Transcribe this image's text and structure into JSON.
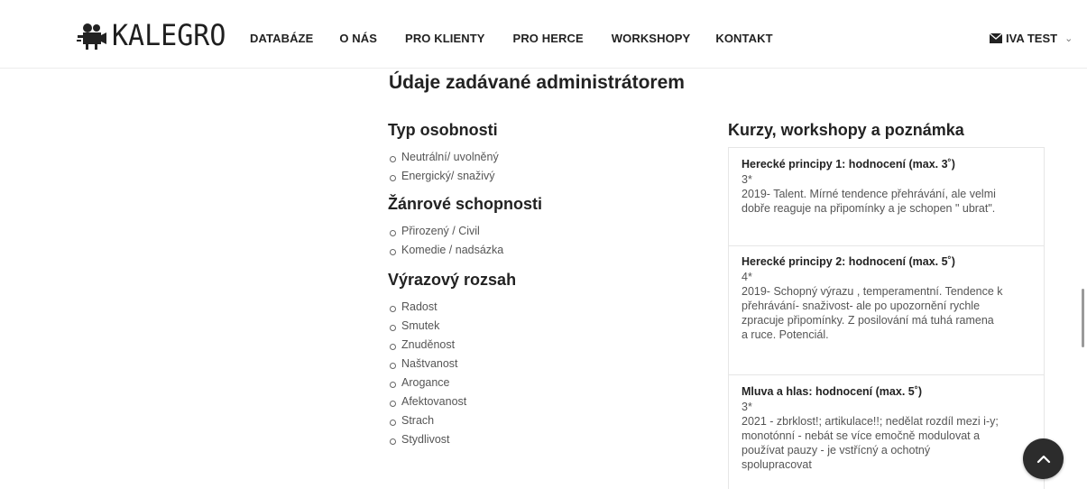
{
  "brand": {
    "name": "KALEGRO"
  },
  "nav": {
    "items": [
      {
        "label": "DATABÁZE"
      },
      {
        "label": "O NÁS"
      },
      {
        "label": "PRO KLIENTY"
      },
      {
        "label": "PRO HERCE"
      },
      {
        "label": "WORKSHOPY"
      },
      {
        "label": "KONTAKT"
      }
    ],
    "user": {
      "label": "IVA TEST",
      "icon": "envelope-icon"
    }
  },
  "page": {
    "title": "Údaje zadávané administrátorem"
  },
  "left": {
    "sections": [
      {
        "heading": "Typ osobnosti",
        "items": [
          "Neutrální/ uvolněný",
          "Energický/ snaživý"
        ]
      },
      {
        "heading": "Žánrové schopnosti",
        "items": [
          "Přirozený / Civil",
          "Komedie / nadsázka"
        ]
      },
      {
        "heading": "Výrazový rozsah",
        "items": [
          "Radost",
          "Smutek",
          "Znuděnost",
          "Naštvanost",
          "Arogance",
          "Afektovanost",
          "Strach",
          "Stydlivost"
        ]
      }
    ]
  },
  "right": {
    "heading": "Kurzy, workshopy a poznámka",
    "items": [
      {
        "title": "Herecké principy 1: hodnocení (max. 3˚)",
        "rating": "3*",
        "lines": [
          "2019- Talent. Mírné tendence přehrávání, ale velmi",
          "dobře reaguje na připomínky a je schopen \" ubrat\"."
        ]
      },
      {
        "title": "Herecké principy 2: hodnocení (max. 5˚)",
        "rating": "4*",
        "lines": [
          "2019- Schopný výrazu , temperamentní. Tendence k",
          "přehrávání- snaživost- ale po upozornění rychle",
          "zpracuje připomínky. Z posilování má tuhá ramena",
          "a ruce. Potenciál."
        ]
      },
      {
        "title": "Mluva a hlas: hodnocení (max. 5˚)",
        "rating": "3*",
        "lines": [
          "2021 - zbrklost!; artikulace!!; nedělat rozdíl mezi i-y;",
          "monotónní - nebát se více emočně modulovat a",
          "používat pauzy - je vstřícný a ochotný",
          "spolupracovat"
        ]
      }
    ]
  },
  "colors": {
    "text": "#222222",
    "muted": "#555555",
    "button": "#2c2c2c",
    "border": "#e6e6e6"
  }
}
